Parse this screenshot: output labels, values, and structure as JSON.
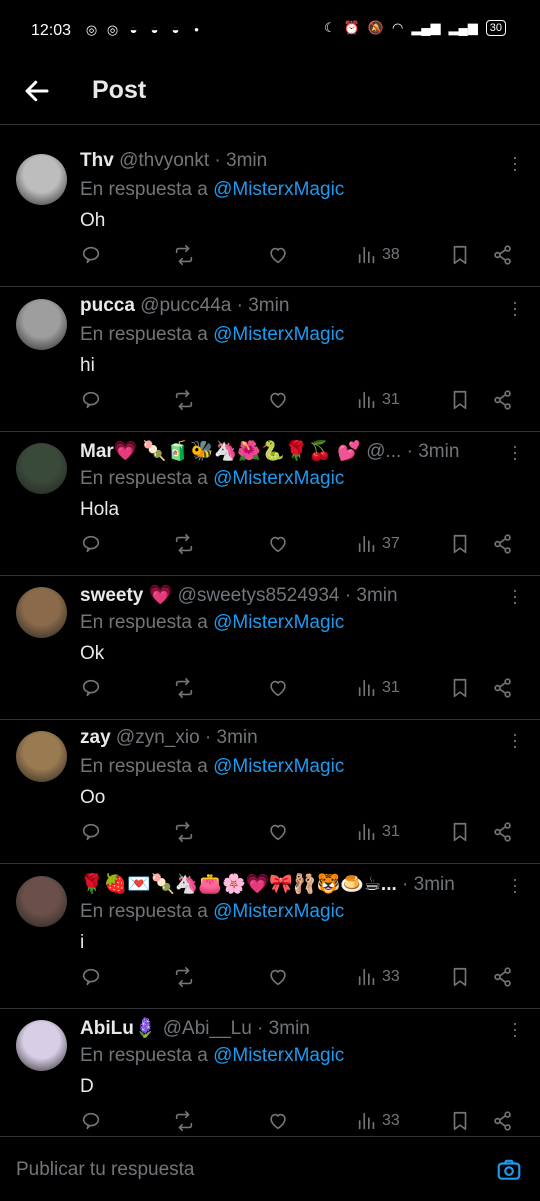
{
  "status_bar": {
    "time": "12:03",
    "battery": "30",
    "network": "Vo\nLTE"
  },
  "header": {
    "title": "Post"
  },
  "posts": [
    {
      "name": "Thv",
      "handle": "@thvyonkt",
      "time": "· 3min",
      "reply_prefix": "En respuesta a",
      "mention": "@MisterxMagic",
      "text": "Oh",
      "views": "38",
      "avatar_color": "#bdbdbd"
    },
    {
      "name": "pucca",
      "handle": "@pucc44a",
      "time": "· 3min",
      "reply_prefix": "En respuesta a",
      "mention": "@MisterxMagic",
      "text": "hi",
      "views": "31",
      "avatar_color": "#9e9e9e"
    },
    {
      "name": "Mar💗 🍡🧃🐝🦄🌺🐍🌹🍒 💕",
      "handle": "@...",
      "time": "· 3min",
      "reply_prefix": "En respuesta a",
      "mention": "@MisterxMagic",
      "text": "Hola",
      "views": "37",
      "avatar_color": "#3a4a3a"
    },
    {
      "name": "sweety 💗",
      "handle": "@sweetys8524934",
      "time": "· 3min",
      "reply_prefix": "En respuesta a",
      "mention": "@MisterxMagic",
      "text": "Ok",
      "views": "31",
      "avatar_color": "#8a6a4a"
    },
    {
      "name": "zay",
      "handle": "@zyn_xio",
      "time": "· 3min",
      "reply_prefix": "En respuesta a",
      "mention": "@MisterxMagic",
      "text": "Oo",
      "views": "31",
      "avatar_color": "#9a7a50"
    },
    {
      "name": "🌹🍓💌🍡🦄👛🌸💗🎀🩰🐯🍮☕...",
      "handle": "",
      "time": "· 3min",
      "reply_prefix": "En respuesta a",
      "mention": "@MisterxMagic",
      "text": "i",
      "views": "33",
      "avatar_color": "#6a5048"
    },
    {
      "name": "AbiLu🪻",
      "handle": "@Abi__Lu",
      "time": "· 3min",
      "reply_prefix": "En respuesta a",
      "mention": "@MisterxMagic",
      "text": "D",
      "views": "33",
      "avatar_color": "#d8cfe6"
    }
  ],
  "composer": {
    "placeholder": "Publicar tu respuesta"
  },
  "colors": {
    "accent": "#1d9bf0",
    "muted": "#71767b",
    "text": "#e7e9ea",
    "divider": "#2f3336"
  }
}
